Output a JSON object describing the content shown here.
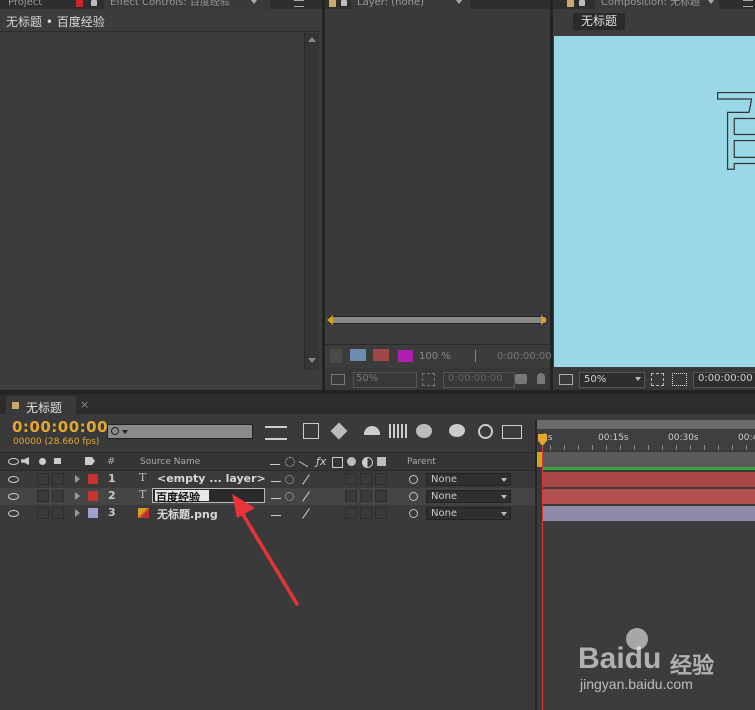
{
  "panels": {
    "project": {
      "tab_label": "Project",
      "effect_controls_tab": "Effect Controls: 百度经验",
      "breadcrumb": "无标题 • 百度经验"
    },
    "layer_viewer": {
      "tab_label": "Layer: (none)",
      "zoom": "100 %",
      "timecode": "0:00:00:00"
    },
    "composition": {
      "tab_label": "Composition: 无标题",
      "comp_button": "无标题",
      "canvas_text": "百",
      "zoom": "50%",
      "timecode": "0:00:00:00",
      "bg_color": "#9ad8e8"
    },
    "layer_viewer_footer": {
      "zoom": "50%",
      "timecode": "0:00:00:00"
    }
  },
  "timeline": {
    "tab_label": "无标题",
    "timecode": "0:00:00:00",
    "frames_fps": "00000 (28.660 fps)",
    "search_placeholder": "",
    "column_source_name": "Source Name",
    "column_number": "#",
    "column_parent": "Parent",
    "ruler_labels": [
      "0s",
      "00:15s",
      "00:30s",
      "00:4"
    ],
    "layers": [
      {
        "num": "1",
        "type": "T",
        "name": "<empty ... layer>",
        "color": "#c83232",
        "parent": "None",
        "track_color": "#a84646"
      },
      {
        "num": "2",
        "type": "T",
        "name": "百度经验",
        "color": "#c83232",
        "parent": "None",
        "track_color": "#b45050"
      },
      {
        "num": "3",
        "type": "img",
        "name": "无标题.png",
        "color": "#a0a0d0",
        "parent": "None",
        "track_color": "#8f8aa8"
      }
    ]
  },
  "watermark": {
    "brand": "Baidu",
    "suffix": "经验",
    "url": "jingyan.baidu.com"
  },
  "colors": {
    "accent_timecode": "#e5a82e",
    "playhead": "#d23c3c"
  }
}
